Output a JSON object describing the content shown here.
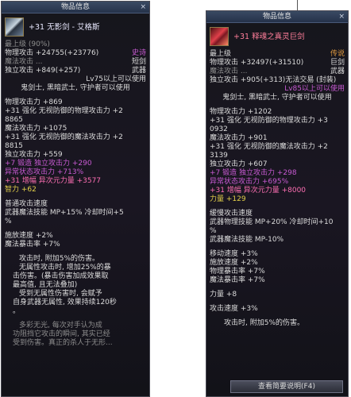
{
  "left": {
    "title": "物品信息",
    "close": "×",
    "item_name": "+31 无影剑 - 艾格斯",
    "rows": [
      {
        "l": "最上级 (90%)",
        "r": ""
      },
      {
        "l": "物理攻击 +24755(+23776)",
        "r": "史诗"
      },
      {
        "l": "魔法攻击 ...",
        "r": "短剑"
      },
      {
        "l": "独立攻击 +849(+257)",
        "r": "武器"
      }
    ],
    "req_line": "Lv75以上可以使用",
    "class_line": "鬼剑士, 黑暗武士, 守护者可以使用",
    "stats": [
      "物理攻击力 +869",
      "+31 强化  无视防御的物理攻击力 +2",
      "8865",
      "魔法攻击力 +1075",
      "+31 强化  无视防御的魔法攻击力 +2",
      "8815",
      "独立攻击力 +559",
      "+7 锻造  独立攻击力 +290",
      "异常状态攻击力 +713%",
      "+31 增幅  异次元力量 +3577",
      "智力 +62"
    ],
    "attack_speed_hdr": "普通攻击速度",
    "skill_line": "武器魔法技能    MP+15% 冷却时间+5",
    "skill_line2": "%",
    "misc": [
      "施放速度 +2%",
      "魔法暴击率 +7%"
    ],
    "desc": [
      "攻击时, 附加5%的伤害。",
      "无属性攻击时, 增加25%的暴",
      "击伤害。(暴击伤害加成效果取",
      "最高值, 且无法叠加)",
      "受到无属性伤害时, 会赋予",
      "自身武器无属性, 效果持续120秒",
      "。",
      "",
      "多彩无光, 每次对手认为成",
      "功阻挡它攻击的瞬间, 其实已经",
      "受到伤害。真正的杀人于无形..."
    ]
  },
  "right": {
    "title": "物品信息",
    "close": "×",
    "item_name": "+31 释魂之真灵巨剑",
    "rows": [
      {
        "l": "最上级",
        "r": "传说"
      },
      {
        "l": "物理攻击 +32497(+31510)",
        "r": "巨剑"
      },
      {
        "l": "魔法攻击 ...",
        "r": "武器"
      },
      {
        "l": "独立攻击 +905(+313)无法交易 (封装)",
        "r": ""
      }
    ],
    "req_line": "Lv85以上可以使用",
    "class_line": "鬼剑士, 黑暗武士, 守护者可以使用",
    "stats": [
      "物理攻击力 +1202",
      "+31 强化  无视防御的物理攻击力 +3",
      "0932",
      "魔法攻击力 +901",
      "+31 强化  无视防御的魔法攻击力 +2",
      "3139",
      "独立攻击力 +607",
      "+7 锻造  独立攻击力 +298",
      "异常状态攻击力 +695%",
      "+31 增幅  异次元力量 +8000",
      "力量 +129"
    ],
    "attack_speed_hdr": "缓慢攻击速度",
    "skill_line": "武器物理技能    MP+20% 冷却时间+10",
    "skill_line2": "%",
    "skill_line3": "武器魔法技能    MP-10%",
    "misc": [
      "移动速度 +3%",
      "施放速度 +2%",
      "物理暴击率 +7%",
      "魔法暴击率 +7%"
    ],
    "power": "力量 +8",
    "atk_speed": "攻击速度 +3%",
    "desc": "攻击时, 附加5%的伤害。",
    "button": "查看简要说明(F4)"
  }
}
